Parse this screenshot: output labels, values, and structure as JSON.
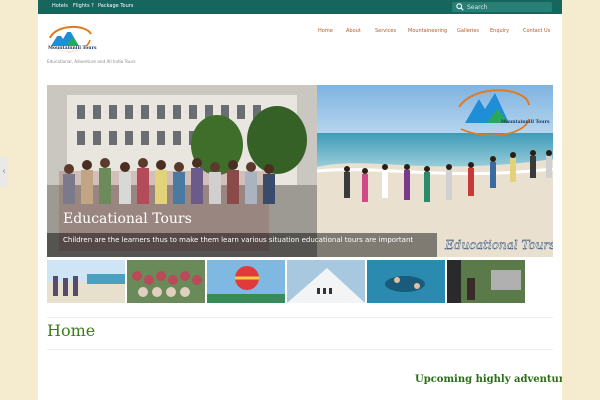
{
  "top_nav": [
    "Hotels",
    "Flights ?",
    "Package Tours"
  ],
  "search": {
    "placeholder": "Search"
  },
  "logo": {
    "text": "Mountainnill Tours"
  },
  "tagline": "Educational, Adventure and All India Tours",
  "main_nav": [
    "Home",
    "About",
    "Services",
    "Mountaineering",
    "Galleries",
    "Enquiry",
    "Contact Us"
  ],
  "slider": {
    "title": "Educational Tours",
    "caption": "Children are the learners thus to make them learn various situation educational tours are important",
    "watermark": "Educational Tours",
    "prev_icon": "chevron-left-icon"
  },
  "page_title": "Home",
  "upcoming": "Upcoming highly adventurous d",
  "colors": {
    "topbar": "#17665e",
    "nav": "#b35a2a",
    "heading": "#3c7d1a",
    "background": "#f5ecd0"
  }
}
